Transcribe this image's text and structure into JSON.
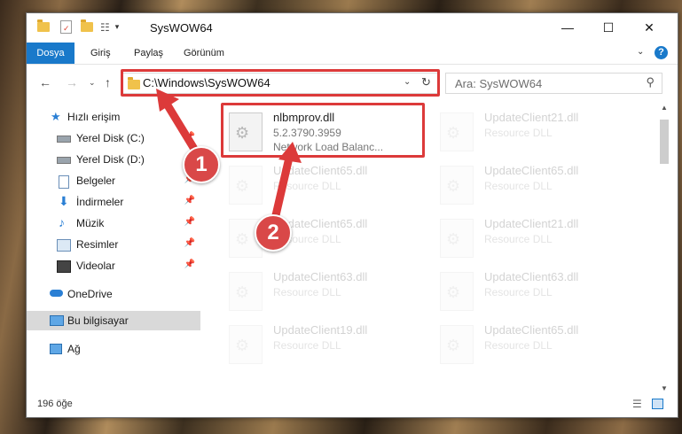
{
  "window": {
    "title": "SysWOW64",
    "minimize": "—",
    "maximize": "☐",
    "close": "✕"
  },
  "ribbon": {
    "tabs": [
      {
        "label": "Dosya"
      },
      {
        "label": "Giriş"
      },
      {
        "label": "Paylaş"
      },
      {
        "label": "Görünüm"
      }
    ],
    "help": "?"
  },
  "address": {
    "path": "C:\\Windows\\SysWOW64",
    "search_placeholder": "Ara: SysWOW64"
  },
  "sidebar": {
    "items": [
      {
        "label": "Hızlı erişim"
      },
      {
        "label": "Yerel Disk (C:)"
      },
      {
        "label": "Yerel Disk (D:)"
      },
      {
        "label": "Belgeler"
      },
      {
        "label": "İndirmeler"
      },
      {
        "label": "Müzik"
      },
      {
        "label": "Resimler"
      },
      {
        "label": "Videolar"
      },
      {
        "label": "OneDrive"
      },
      {
        "label": "Bu bilgisayar"
      },
      {
        "label": "Ağ"
      }
    ]
  },
  "files": {
    "highlight": {
      "name": "nlbmprov.dll",
      "version": "5.2.3790.3959",
      "description": "Network Load Balanc..."
    },
    "others": [
      {
        "name": "UpdateClient21.dll",
        "type": "Resource DLL"
      },
      {
        "name": "UpdateClient65.dll",
        "type": "Resource DLL"
      },
      {
        "name": "UpdateClient65.dll",
        "type": "Resource DLL"
      },
      {
        "name": "UpdateClient65.dll",
        "type": "Resource DLL"
      },
      {
        "name": "UpdateClient21.dll",
        "type": "Resource DLL"
      },
      {
        "name": "UpdateClient63.dll",
        "type": "Resource DLL"
      },
      {
        "name": "UpdateClient63.dll",
        "type": "Resource DLL"
      },
      {
        "name": "UpdateClient19.dll",
        "type": "Resource DLL"
      },
      {
        "name": "UpdateClient65.dll",
        "type": "Resource DLL"
      }
    ]
  },
  "status": {
    "count": "196 öğe"
  },
  "annotations": {
    "step1": "1",
    "step2": "2",
    "color": "#dc3a3a"
  }
}
